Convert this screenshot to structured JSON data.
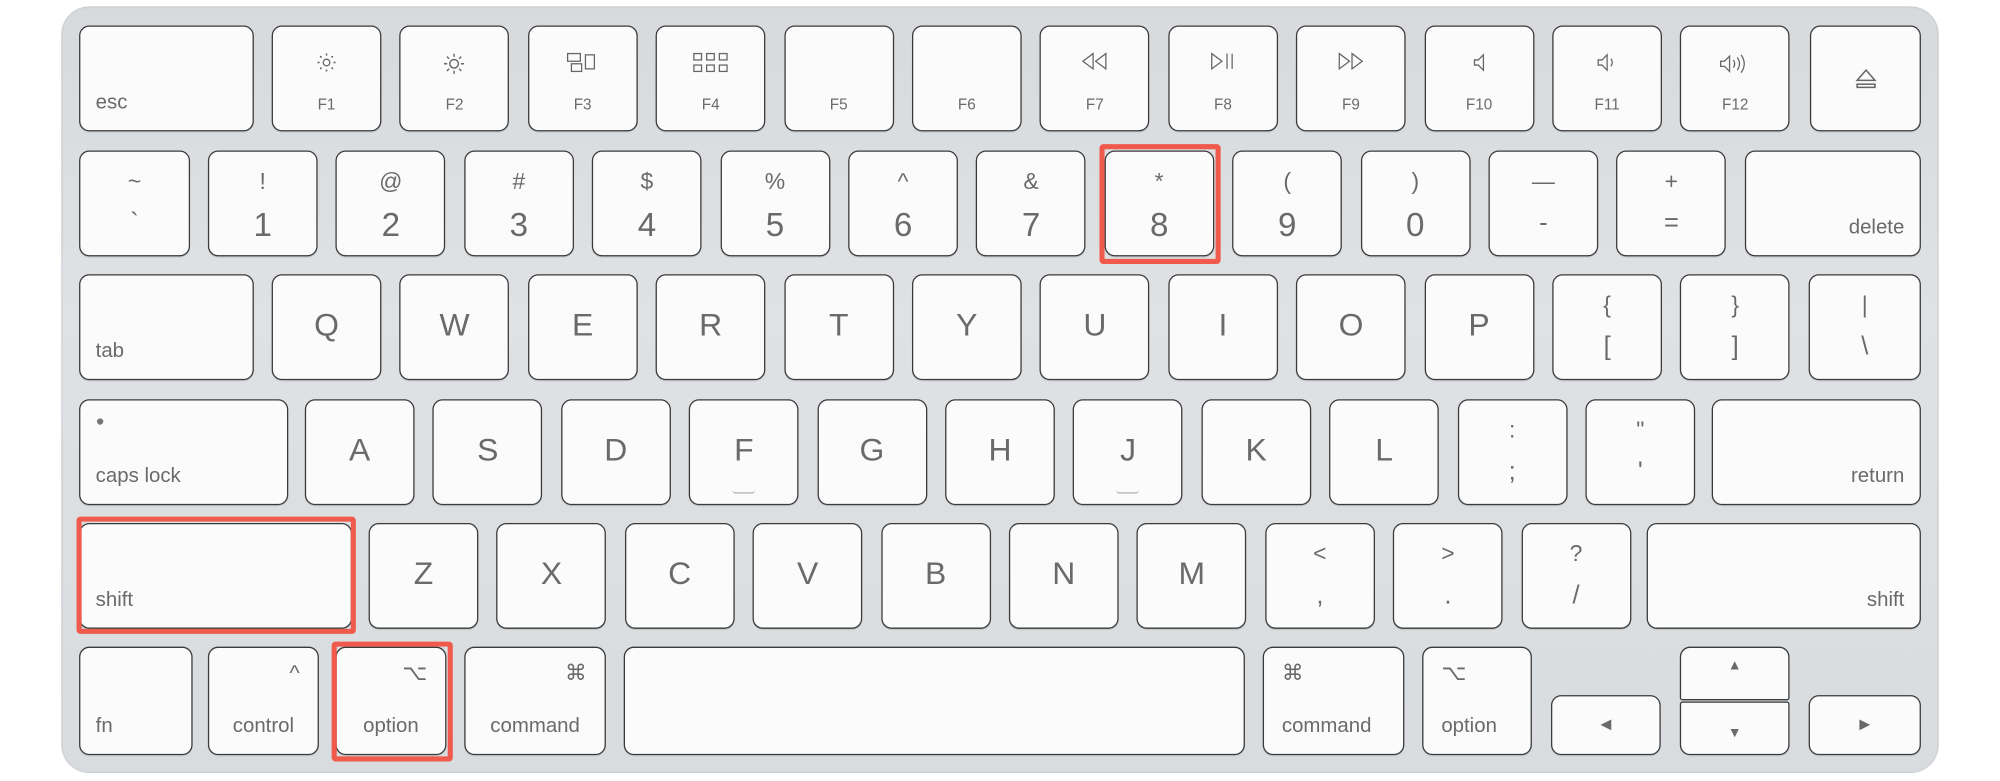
{
  "highlight_color": "#f05a4c",
  "highlighted_keys": [
    "8",
    "shift-left",
    "option-left"
  ],
  "rows": {
    "function": [
      {
        "id": "esc",
        "label": "esc"
      },
      {
        "id": "f1",
        "label": "F1",
        "icon": "brightness-down-icon"
      },
      {
        "id": "f2",
        "label": "F2",
        "icon": "brightness-up-icon"
      },
      {
        "id": "f3",
        "label": "F3",
        "icon": "mission-control-icon"
      },
      {
        "id": "f4",
        "label": "F4",
        "icon": "launchpad-icon"
      },
      {
        "id": "f5",
        "label": "F5"
      },
      {
        "id": "f6",
        "label": "F6"
      },
      {
        "id": "f7",
        "label": "F7",
        "icon": "rewind-icon"
      },
      {
        "id": "f8",
        "label": "F8",
        "icon": "play-pause-icon"
      },
      {
        "id": "f9",
        "label": "F9",
        "icon": "fast-forward-icon"
      },
      {
        "id": "f10",
        "label": "F10",
        "icon": "mute-icon"
      },
      {
        "id": "f11",
        "label": "F11",
        "icon": "volume-down-icon"
      },
      {
        "id": "f12",
        "label": "F12",
        "icon": "volume-up-icon"
      },
      {
        "id": "eject",
        "icon": "eject-icon"
      }
    ],
    "number": [
      {
        "id": "grave",
        "top": "~",
        "bottom": "`"
      },
      {
        "id": "1",
        "top": "!",
        "bottom": "1"
      },
      {
        "id": "2",
        "top": "@",
        "bottom": "2"
      },
      {
        "id": "3",
        "top": "#",
        "bottom": "3"
      },
      {
        "id": "4",
        "top": "$",
        "bottom": "4"
      },
      {
        "id": "5",
        "top": "%",
        "bottom": "5"
      },
      {
        "id": "6",
        "top": "^",
        "bottom": "6"
      },
      {
        "id": "7",
        "top": "&",
        "bottom": "7"
      },
      {
        "id": "8",
        "top": "*",
        "bottom": "8"
      },
      {
        "id": "9",
        "top": "(",
        "bottom": "9"
      },
      {
        "id": "0",
        "top": ")",
        "bottom": "0"
      },
      {
        "id": "minus",
        "top": "—",
        "bottom": "-"
      },
      {
        "id": "equals",
        "top": "+",
        "bottom": "="
      },
      {
        "id": "delete",
        "label": "delete"
      }
    ],
    "top": [
      {
        "id": "tab",
        "label": "tab"
      },
      {
        "id": "q",
        "label": "Q"
      },
      {
        "id": "w",
        "label": "W"
      },
      {
        "id": "e",
        "label": "E"
      },
      {
        "id": "r",
        "label": "R"
      },
      {
        "id": "t",
        "label": "T"
      },
      {
        "id": "y",
        "label": "Y"
      },
      {
        "id": "u",
        "label": "U"
      },
      {
        "id": "i",
        "label": "I"
      },
      {
        "id": "o",
        "label": "O"
      },
      {
        "id": "p",
        "label": "P"
      },
      {
        "id": "lbracket",
        "top": "{",
        "bottom": "["
      },
      {
        "id": "rbracket",
        "top": "}",
        "bottom": "]"
      },
      {
        "id": "backslash",
        "top": "|",
        "bottom": "\\"
      }
    ],
    "home": [
      {
        "id": "caps-lock",
        "label": "caps lock"
      },
      {
        "id": "a",
        "label": "A"
      },
      {
        "id": "s",
        "label": "S"
      },
      {
        "id": "d",
        "label": "D"
      },
      {
        "id": "f",
        "label": "F"
      },
      {
        "id": "g",
        "label": "G"
      },
      {
        "id": "h",
        "label": "H"
      },
      {
        "id": "j",
        "label": "J"
      },
      {
        "id": "k",
        "label": "K"
      },
      {
        "id": "l",
        "label": "L"
      },
      {
        "id": "semicolon",
        "top": ":",
        "bottom": ";"
      },
      {
        "id": "quote",
        "top": "\"",
        "bottom": "'"
      },
      {
        "id": "return",
        "label": "return"
      }
    ],
    "bottom": [
      {
        "id": "shift-left",
        "label": "shift"
      },
      {
        "id": "z",
        "label": "Z"
      },
      {
        "id": "x",
        "label": "X"
      },
      {
        "id": "c",
        "label": "C"
      },
      {
        "id": "v",
        "label": "V"
      },
      {
        "id": "b",
        "label": "B"
      },
      {
        "id": "n",
        "label": "N"
      },
      {
        "id": "m",
        "label": "M"
      },
      {
        "id": "comma",
        "top": "<",
        "bottom": ","
      },
      {
        "id": "period",
        "top": ">",
        "bottom": "."
      },
      {
        "id": "slash",
        "top": "?",
        "bottom": "/"
      },
      {
        "id": "shift-right",
        "label": "shift"
      }
    ],
    "modifier": [
      {
        "id": "fn",
        "label": "fn"
      },
      {
        "id": "control-left",
        "label": "control",
        "symbol": "^"
      },
      {
        "id": "option-left",
        "label": "option",
        "symbol": "⌥"
      },
      {
        "id": "command-left",
        "label": "command",
        "symbol": "⌘"
      },
      {
        "id": "space"
      },
      {
        "id": "command-right",
        "label": "command",
        "symbol": "⌘"
      },
      {
        "id": "option-right",
        "label": "option",
        "symbol": "⌥"
      },
      {
        "id": "arrow-left",
        "symbol": "◀"
      },
      {
        "id": "arrow-up",
        "symbol": "▲"
      },
      {
        "id": "arrow-down",
        "symbol": "▼"
      },
      {
        "id": "arrow-right",
        "symbol": "▶"
      }
    ]
  }
}
